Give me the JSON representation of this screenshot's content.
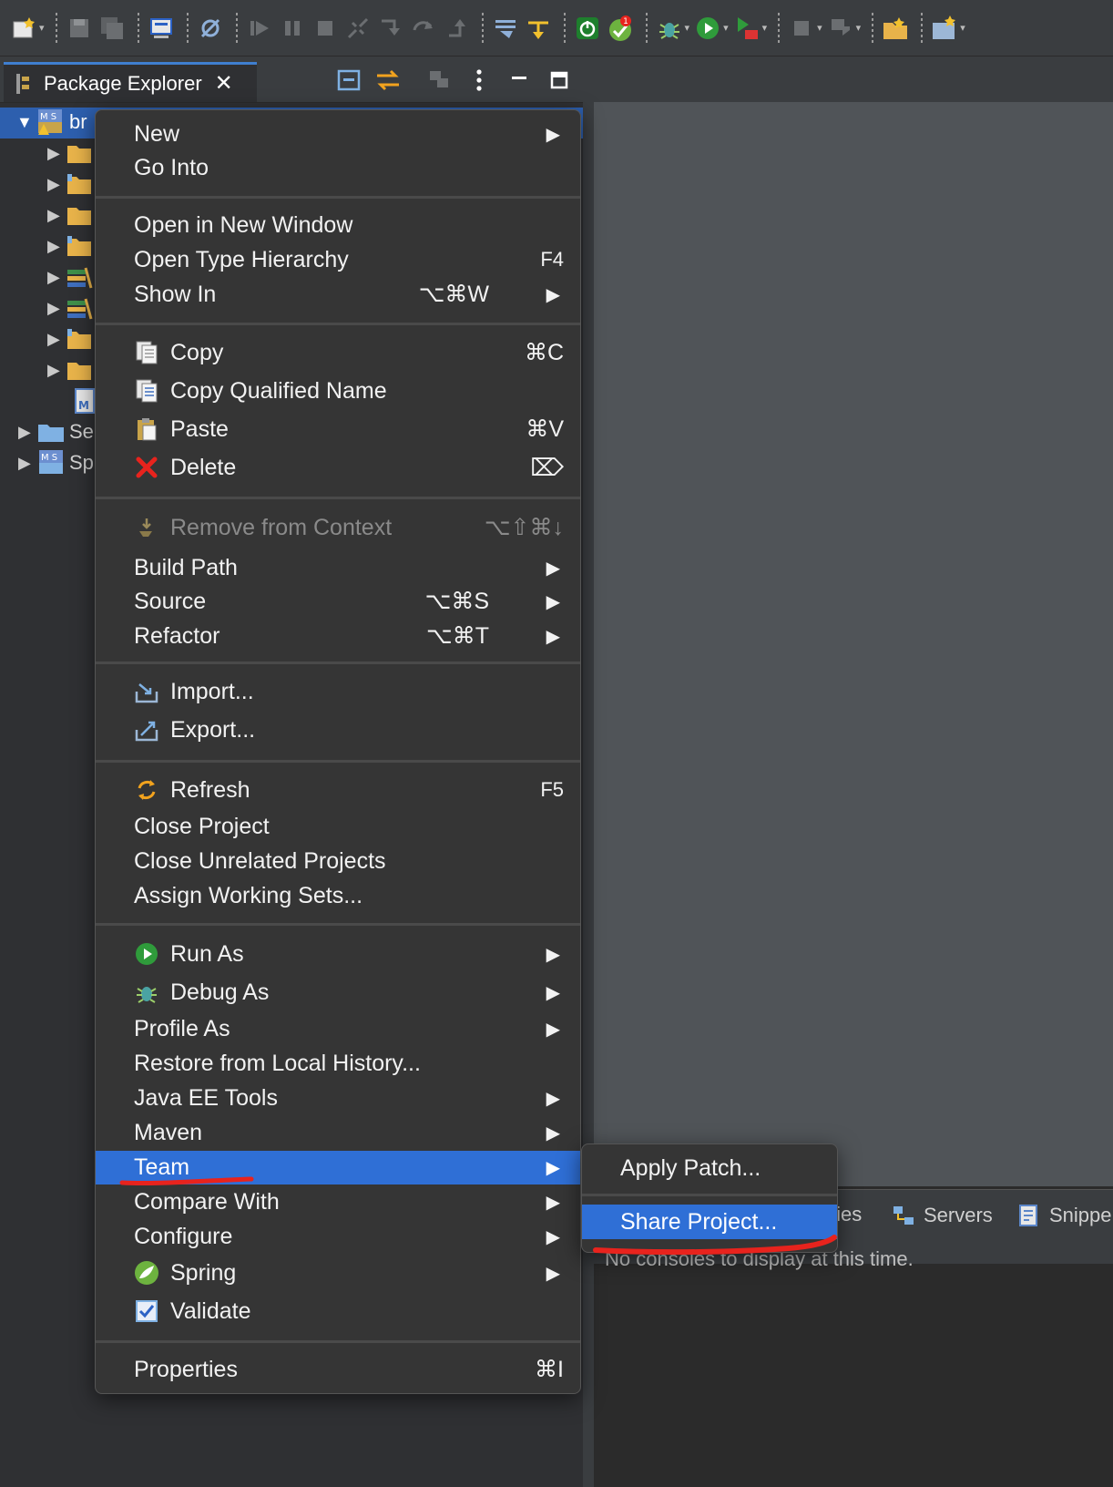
{
  "explorer": {
    "tab_title": "Package Explorer",
    "close_glyph": "✕",
    "tree": [
      {
        "label": "br",
        "expanded": true,
        "selected": true,
        "icon": "maven-project-icon"
      },
      {
        "label": "",
        "icon": "package-folder-icon"
      },
      {
        "label": "",
        "icon": "package-folder-icon"
      },
      {
        "label": "",
        "icon": "package-folder-icon"
      },
      {
        "label": "",
        "icon": "package-folder-icon"
      },
      {
        "label": "",
        "icon": "library-icon"
      },
      {
        "label": "",
        "icon": "library-icon"
      },
      {
        "label": "",
        "icon": "package-folder-icon"
      },
      {
        "label": "",
        "icon": "folder-icon"
      },
      {
        "label": "",
        "icon": "pom-file-icon"
      },
      {
        "label": "Se",
        "icon": "folder-icon"
      },
      {
        "label": "Sp",
        "icon": "maven-project-icon"
      }
    ]
  },
  "menu": {
    "items": [
      {
        "label": "New",
        "shortcut": "",
        "submenu": true
      },
      {
        "label": "Go Into",
        "shortcut": ""
      },
      {
        "label": "Open in New Window",
        "shortcut": ""
      },
      {
        "label": "Open Type Hierarchy",
        "shortcut": "F4"
      },
      {
        "label": "Show In",
        "shortcut": "⌥⌘W",
        "submenu": true
      },
      {
        "label": "Copy",
        "shortcut": "⌘C",
        "icon": "copy-icon"
      },
      {
        "label": "Copy Qualified Name",
        "shortcut": "",
        "icon": "copy-qualified-icon"
      },
      {
        "label": "Paste",
        "shortcut": "⌘V",
        "icon": "paste-icon"
      },
      {
        "label": "Delete",
        "shortcut": "⌦",
        "icon": "delete-icon"
      },
      {
        "label": "Remove from Context",
        "shortcut": "⌥⇧⌘↓",
        "disabled": true,
        "icon": "remove-context-icon"
      },
      {
        "label": "Build Path",
        "shortcut": "",
        "submenu": true
      },
      {
        "label": "Source",
        "shortcut": "⌥⌘S",
        "submenu": true
      },
      {
        "label": "Refactor",
        "shortcut": "⌥⌘T",
        "submenu": true
      },
      {
        "label": "Import...",
        "shortcut": "",
        "icon": "import-icon"
      },
      {
        "label": "Export...",
        "shortcut": "",
        "icon": "export-icon"
      },
      {
        "label": "Refresh",
        "shortcut": "F5",
        "icon": "refresh-icon"
      },
      {
        "label": "Close Project",
        "shortcut": ""
      },
      {
        "label": "Close Unrelated Projects",
        "shortcut": ""
      },
      {
        "label": "Assign Working Sets...",
        "shortcut": ""
      },
      {
        "label": "Run As",
        "shortcut": "",
        "submenu": true,
        "icon": "run-icon"
      },
      {
        "label": "Debug As",
        "shortcut": "",
        "submenu": true,
        "icon": "debug-icon"
      },
      {
        "label": "Profile As",
        "shortcut": "",
        "submenu": true
      },
      {
        "label": "Restore from Local History...",
        "shortcut": ""
      },
      {
        "label": "Java EE Tools",
        "shortcut": "",
        "submenu": true
      },
      {
        "label": "Maven",
        "shortcut": "",
        "submenu": true
      },
      {
        "label": "Team",
        "shortcut": "",
        "submenu": true,
        "highlighted": true
      },
      {
        "label": "Compare With",
        "shortcut": "",
        "submenu": true
      },
      {
        "label": "Configure",
        "shortcut": "",
        "submenu": true
      },
      {
        "label": "Spring",
        "shortcut": "",
        "submenu": true,
        "icon": "spring-icon"
      },
      {
        "label": "Validate",
        "shortcut": "",
        "icon": "validate-checkbox-icon"
      },
      {
        "label": "Properties",
        "shortcut": "⌘I"
      }
    ],
    "arrow_glyph": "▶"
  },
  "submenu": {
    "items": [
      {
        "label": "Apply Patch..."
      },
      {
        "label": "Share Project...",
        "highlighted": true
      }
    ]
  },
  "console": {
    "tabs": [
      "ties",
      "Servers",
      "Snippe"
    ],
    "message": "No consoles to display at this time."
  },
  "colors": {
    "highlight": "#2f6fd6",
    "annotation_red": "#e8231d"
  }
}
